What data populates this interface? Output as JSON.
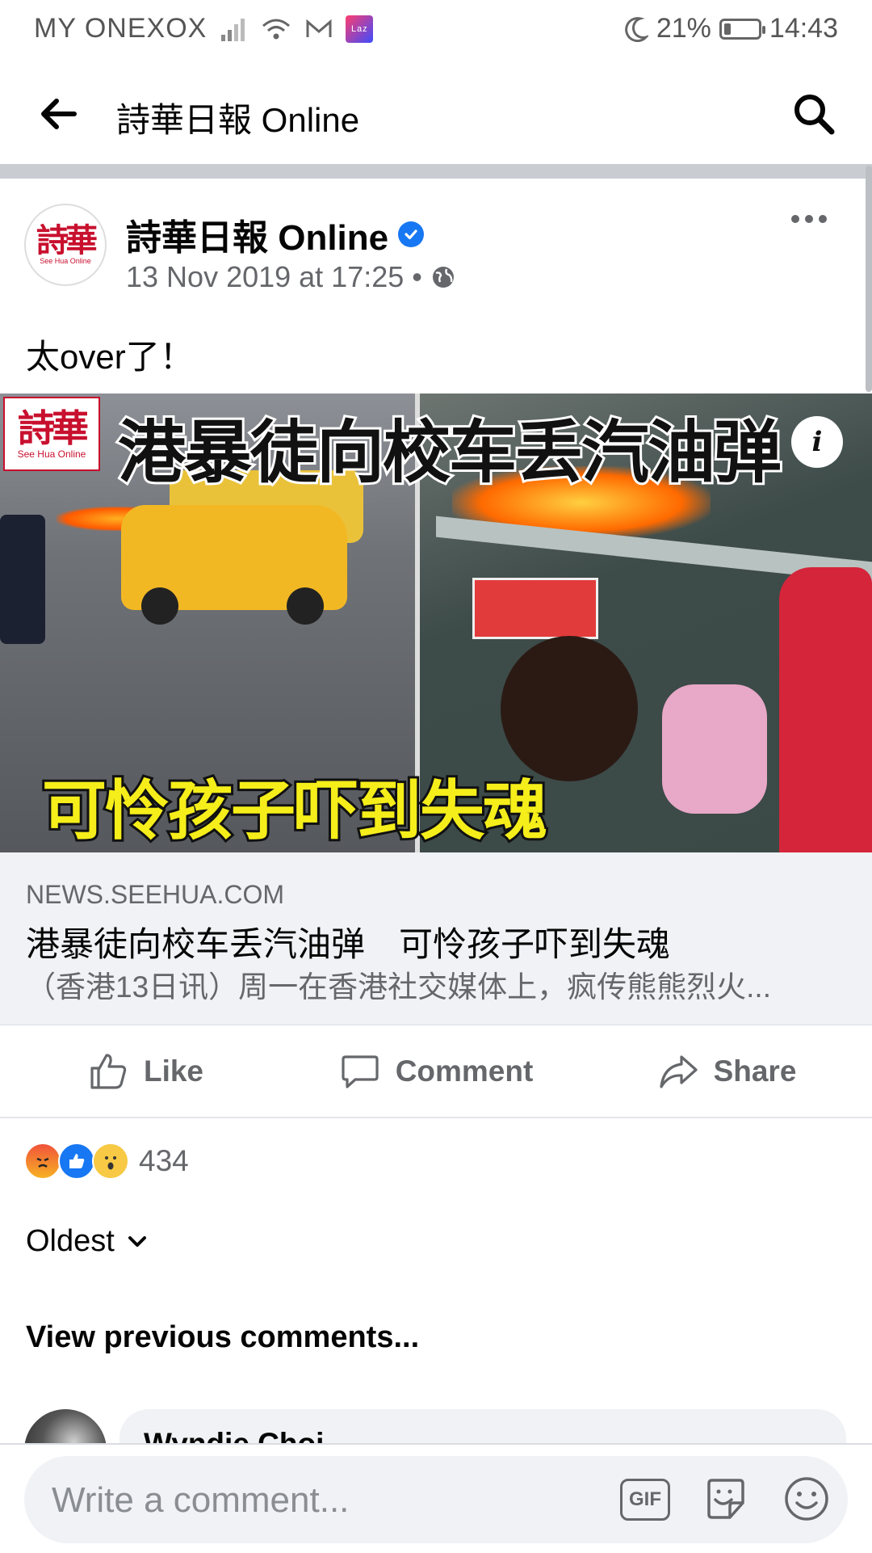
{
  "status_bar": {
    "carrier": "MY ONEXOX",
    "laz_badge": "Laz",
    "battery_percent": "21%",
    "battery_level": 0.21,
    "time": "14:43"
  },
  "header": {
    "title": "詩華日報 Online"
  },
  "post": {
    "page_name": "詩華日報 Online",
    "avatar_logo": "詩華",
    "avatar_sub": "See Hua Online",
    "timestamp": "13 Nov 2019 at 17:25 •",
    "text": "太over了！",
    "image": {
      "logo_chars": "詩華",
      "logo_sub": "See Hua Online",
      "headline": "港暴徒向校车丢汽油弹",
      "caption": "可怜孩子吓到失魂",
      "info_glyph": "i"
    },
    "link": {
      "domain": "NEWS.SEEHUA.COM",
      "title": "港暴徒向校车丢汽油弹　可怜孩子吓到失魂",
      "description": "（香港13日讯）周一在香港社交媒体上，疯传熊熊烈火..."
    }
  },
  "actions": {
    "like": "Like",
    "comment": "Comment",
    "share": "Share"
  },
  "reactions": {
    "count": "434",
    "types": [
      "angry",
      "like",
      "wow"
    ]
  },
  "comments": {
    "sort_label": "Oldest",
    "view_previous": "View previous comments...",
    "first_author": "Wyndie Choi"
  },
  "composer": {
    "placeholder": "Write a comment...",
    "gif_label": "GIF"
  },
  "colors": {
    "accent": "#1877f2",
    "muted_text": "#65676b",
    "surface": "#f0f2f5"
  }
}
